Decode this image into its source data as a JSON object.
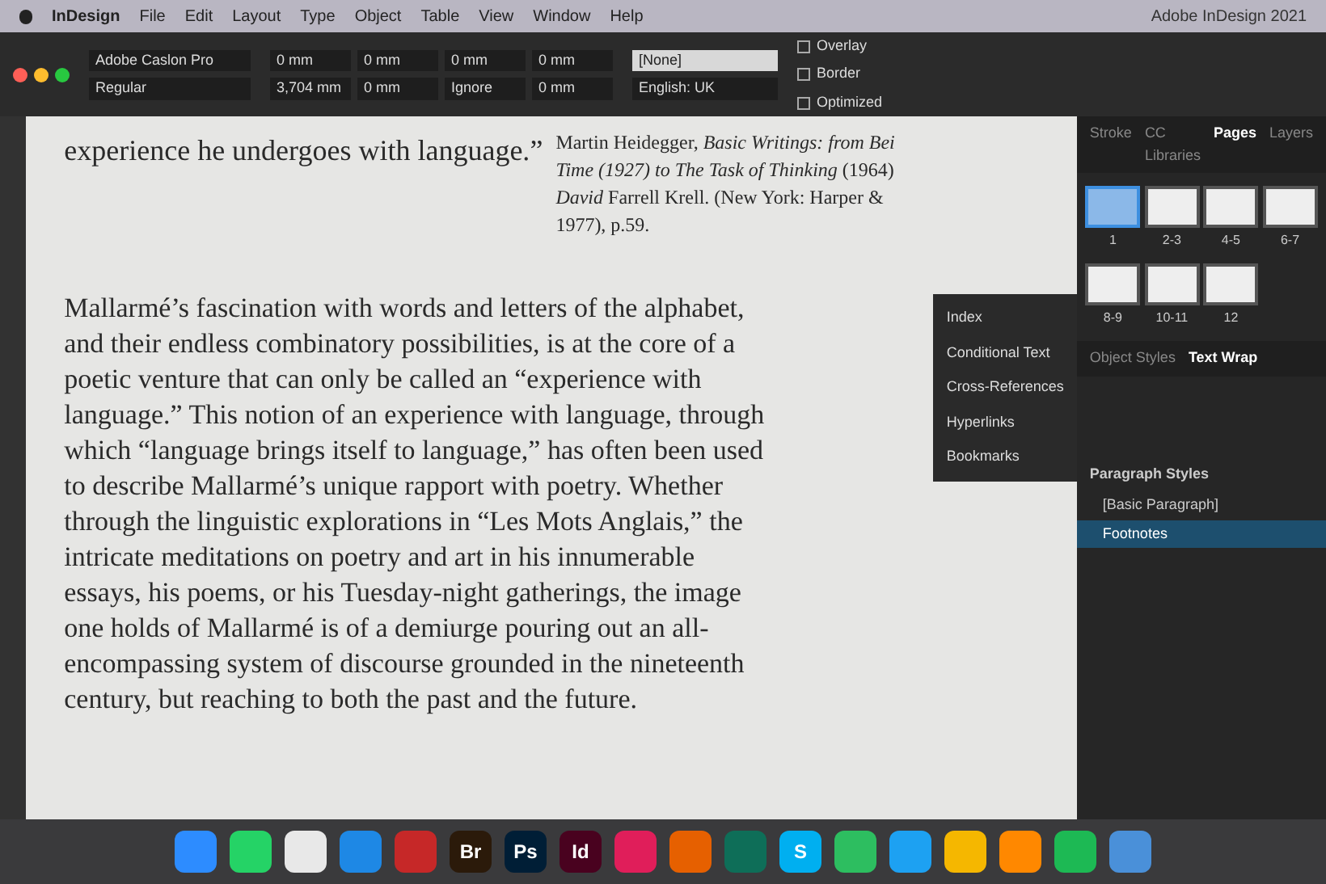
{
  "menu_bar": {
    "items": [
      "InDesign",
      "File",
      "Edit",
      "Layout",
      "Type",
      "Object",
      "Table",
      "View",
      "Window",
      "Help"
    ],
    "title": "Adobe InDesign 2021"
  },
  "control_panel": {
    "font": "Adobe Caslon Pro",
    "style": "Regular",
    "paragraph_style": "[None]",
    "language": "English: UK",
    "fields": [
      "0 mm",
      "0 mm",
      "0 mm",
      "0 mm",
      "3,704 mm",
      "0 mm",
      "Ignore",
      "0 mm"
    ],
    "checkboxes": [
      {
        "label": "Overlay",
        "checked": false
      },
      {
        "label": "Border",
        "checked": false
      },
      {
        "label": "Optimized",
        "checked": false
      }
    ]
  },
  "document": {
    "top_line": "experience he undergoes with language.",
    "quote_mark": "”",
    "footnote": [
      "Martin Heidegger, *Basic Writings: from Bei*",
      "*Time (1927) to The Task of Thinking* (1964)",
      "*David* Farrell Krell. (New York: Harper &",
      "1977), p.59."
    ],
    "paragraph": "Mallarmé’s fascination with words and letters of the alphabet, and their endless combinatory possibilities, is at the core of a poetic venture that can only be called an “experience with language.” This notion of an experience with language, through which “language brings itself to language,” has often been used to describe Mallarmé’s unique rapport with poetry. Whether through the linguistic explorations in “Les Mots Anglais,” the intricate meditations on poetry and art in his innumerable essays, his poems, or his Tuesday-night gatherings, the image one holds of Mallarmé is of a demiurge pouring out an all-encompassing system of discourse grounded in the nineteenth century, but reaching to both the past and the future."
  },
  "panel_tabs": [
    {
      "label": "Stroke",
      "selected": false
    },
    {
      "label": "CC Libraries",
      "selected": false
    },
    {
      "label": "Pages",
      "selected": true
    },
    {
      "label": "Layers",
      "selected": false
    }
  ],
  "pages": [
    {
      "label": "1",
      "selected": true
    },
    {
      "label": "2-3",
      "selected": false
    },
    {
      "label": "4-5",
      "selected": false
    },
    {
      "label": "6-7",
      "selected": false
    },
    {
      "label": "8-9",
      "selected": false
    },
    {
      "label": "10-11",
      "selected": false
    },
    {
      "label": "12",
      "selected": false
    }
  ],
  "side_menu": [
    "Index",
    "Conditional Text",
    "Cross-References",
    "Hyperlinks",
    "Bookmarks"
  ],
  "wrap_tabs": [
    {
      "label": "Object Styles",
      "selected": false
    },
    {
      "label": "Text Wrap",
      "selected": true
    }
  ],
  "paragraph_styles": {
    "title": "Paragraph Styles",
    "items": [
      {
        "label": "[Basic Paragraph]",
        "selected": false
      },
      {
        "label": "Footnotes",
        "selected": true
      }
    ]
  },
  "dock": [
    {
      "kind": "icon",
      "color": "#2d8cff"
    },
    {
      "kind": "icon",
      "color": "#25d366"
    },
    {
      "kind": "icon",
      "color": "#e8e8e8"
    },
    {
      "kind": "icon",
      "color": "#1e88e5"
    },
    {
      "kind": "icon",
      "color": "#c62828"
    },
    {
      "kind": "text",
      "label": "Br",
      "color": "#2b1a0a"
    },
    {
      "kind": "text",
      "label": "Ps",
      "color": "#001e36"
    },
    {
      "kind": "text",
      "label": "Id",
      "color": "#49021f"
    },
    {
      "kind": "icon",
      "color": "#e01e5a"
    },
    {
      "kind": "icon",
      "color": "#e66000"
    },
    {
      "kind": "icon",
      "color": "#0e6e58"
    },
    {
      "kind": "text",
      "label": "S",
      "color": "#00aff0"
    },
    {
      "kind": "icon",
      "color": "#2dbe60"
    },
    {
      "kind": "icon",
      "color": "#1da1f2"
    },
    {
      "kind": "icon",
      "color": "#f5b700"
    },
    {
      "kind": "icon",
      "color": "#ff8800"
    },
    {
      "kind": "icon",
      "color": "#1db954"
    },
    {
      "kind": "icon",
      "color": "#4a90d9"
    }
  ]
}
